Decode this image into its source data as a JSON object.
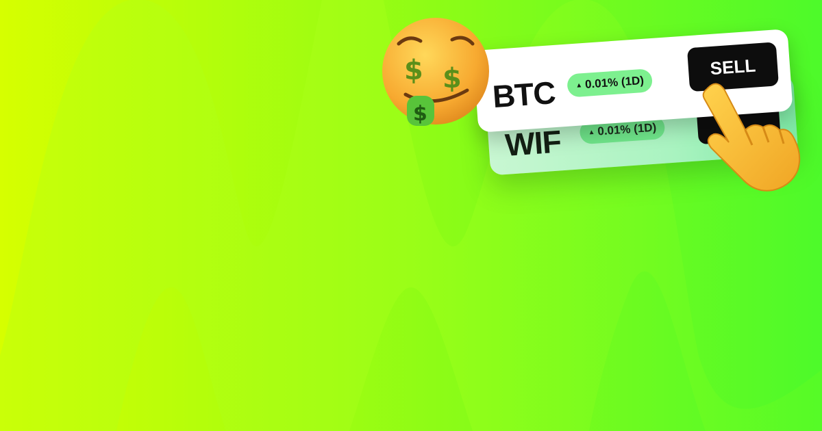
{
  "colors": {
    "bg_left": "#d6ff00",
    "bg_right": "#4dfa2a",
    "wave": "#aaff1a",
    "pill": "#7df08f",
    "sell_button": "#0d0d0d"
  },
  "cards": {
    "front": {
      "ticker": "BTC",
      "change": "0.01% (1D)",
      "action": "SELL"
    },
    "back": {
      "ticker": "WIF",
      "change": "0.01% (1D)"
    }
  },
  "icons": {
    "emoji_face": "money-mouth-face-icon",
    "emoji_hand": "pointing-hand-icon",
    "change_arrow": "triangle-up-icon"
  }
}
